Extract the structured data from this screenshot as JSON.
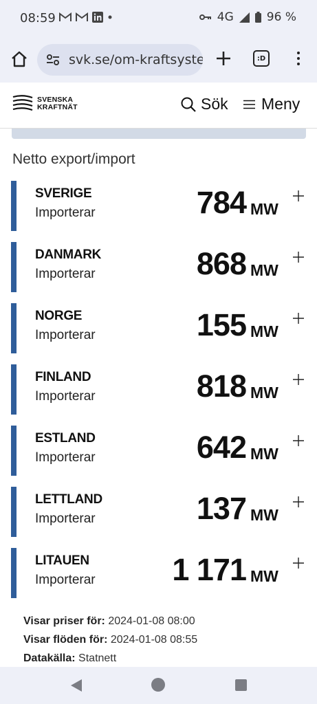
{
  "status_bar": {
    "time": "08:59",
    "network": "4G",
    "battery": "96 %",
    "notification_icons": [
      "gmail-icon",
      "gmail-icon",
      "linkedin-icon",
      "dot-icon"
    ]
  },
  "browser": {
    "url": "svk.se/om-kraftsystem",
    "tabs_label": ":D"
  },
  "site": {
    "logo_line1": "SVENSKA",
    "logo_line2": "KRAFTNÄT",
    "search_label": "Sök",
    "menu_label": "Meny"
  },
  "section_title": "Netto export/import",
  "countries": [
    {
      "name": "SVERIGE",
      "status": "Importerar",
      "value": "784",
      "unit": "MW"
    },
    {
      "name": "DANMARK",
      "status": "Importerar",
      "value": "868",
      "unit": "MW"
    },
    {
      "name": "NORGE",
      "status": "Importerar",
      "value": "155",
      "unit": "MW"
    },
    {
      "name": "FINLAND",
      "status": "Importerar",
      "value": "818",
      "unit": "MW"
    },
    {
      "name": "ESTLAND",
      "status": "Importerar",
      "value": "642",
      "unit": "MW"
    },
    {
      "name": "LETTLAND",
      "status": "Importerar",
      "value": "137",
      "unit": "MW"
    },
    {
      "name": "LITAUEN",
      "status": "Importerar",
      "value": "1 171",
      "unit": "MW"
    }
  ],
  "footer": {
    "prices_label": "Visar priser för:",
    "prices_value": "2024-01-08 08:00",
    "flows_label": "Visar flöden för:",
    "flows_value": "2024-01-08 08:55",
    "source_label": "Datakälla:",
    "source_value": "Statnett"
  },
  "colors": {
    "accent_bar": "#2f5d9a",
    "band": "#d2dae6",
    "chrome": "#eef0f8"
  }
}
